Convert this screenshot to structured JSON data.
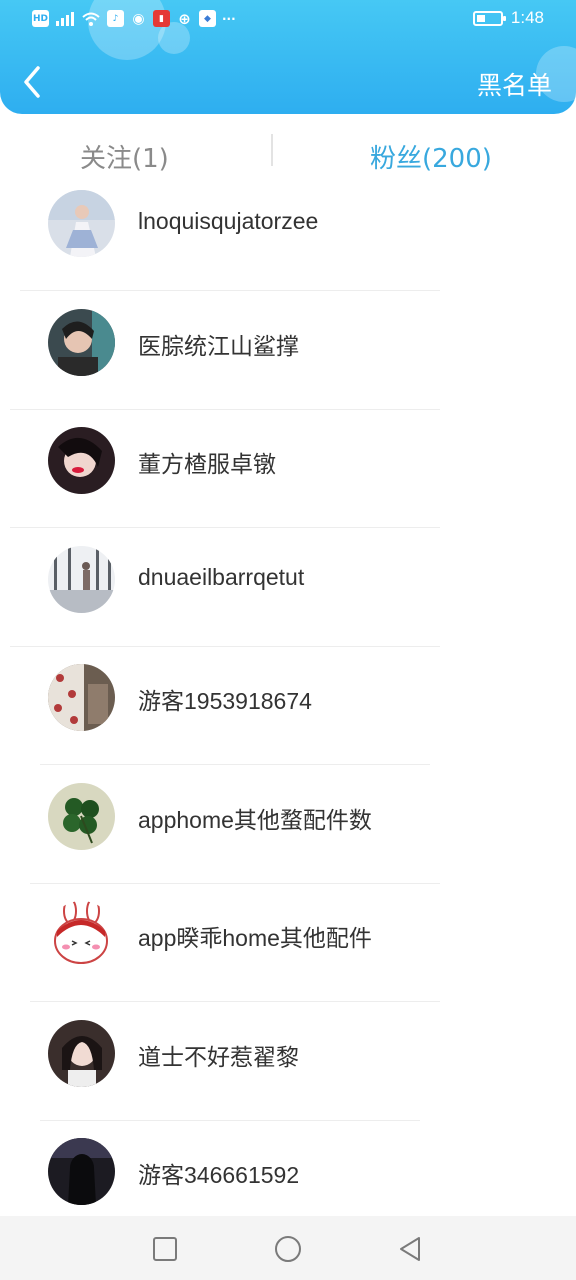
{
  "status_bar": {
    "left_icons": [
      "hd-icon",
      "5g-signal-icon",
      "wifi-icon",
      "music-icon",
      "wechat-icon",
      "red-app-icon",
      "globe-icon",
      "blue-app-icon"
    ],
    "network_label": "HD",
    "more": "···",
    "time": "1:48",
    "battery_level": 0.35
  },
  "header": {
    "blacklist_label": "黑名单",
    "accent_color": "#2eaef0"
  },
  "tabs": {
    "following_label": "关注(1)",
    "fans_label": "粉丝(200)",
    "active": "fans",
    "active_color": "#38a8de"
  },
  "users": [
    {
      "name": "lnoquisqujatorzee",
      "avatar": "girl-in-white-dress-avatar"
    },
    {
      "name": "医腙统江山鲨撑",
      "avatar": "girl-selfie-avatar"
    },
    {
      "name": "董方楂服卓镦",
      "avatar": "girl-red-lips-avatar"
    },
    {
      "name": "dnuaeilbarrqetut",
      "avatar": "silhouette-window-avatar"
    },
    {
      "name": "游客1953918674",
      "avatar": "patterned-fabric-avatar"
    },
    {
      "name": "apphome其他蝥配件数",
      "avatar": "four-leaf-clover-avatar"
    },
    {
      "name": "app暌乖home其他配件",
      "avatar": "cartoon-bunny-avatar"
    },
    {
      "name": "道士不好惹翟黎",
      "avatar": "girl-portrait-avatar"
    },
    {
      "name": "游客346661592",
      "avatar": "long-hair-back-avatar"
    }
  ]
}
